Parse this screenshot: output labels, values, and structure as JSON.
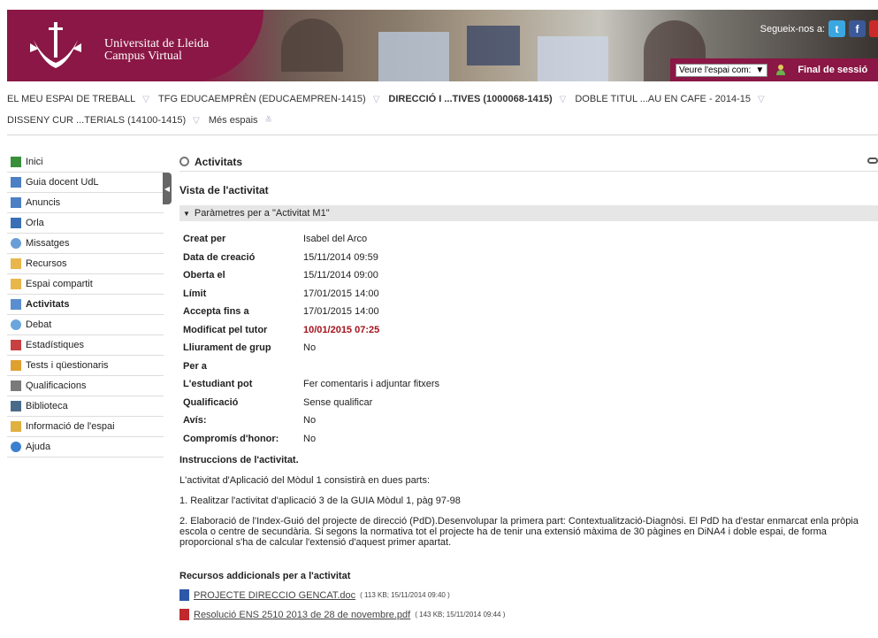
{
  "banner": {
    "uni_line1": "Universitat de Lleida",
    "uni_line2": "Campus Virtual",
    "follow_label": "Segueix-nos a:",
    "espai_select": "Veure l'espai com:",
    "logout": "Final de sessió"
  },
  "topnav": {
    "row1": [
      "EL MEU ESPAI DE TREBALL",
      "TFG EDUCAEMPRÈN (EDUCAEMPREN-1415)",
      "DIRECCIÓ I ...TIVES (1000068-1415)",
      "DOBLE TITUL ...AU EN CAFE - 2014-15"
    ],
    "row2": [
      "DISSENY CUR ...TERIALS (14100-1415)",
      "Més espais"
    ]
  },
  "sidebar": {
    "items": [
      {
        "label": "Inici",
        "icon": "home-icon"
      },
      {
        "label": "Guia docent UdL",
        "icon": "guide-icon"
      },
      {
        "label": "Anuncis",
        "icon": "megaphone-icon"
      },
      {
        "label": "Orla",
        "icon": "orla-icon"
      },
      {
        "label": "Missatges",
        "icon": "message-icon"
      },
      {
        "label": "Recursos",
        "icon": "folder-icon"
      },
      {
        "label": "Espai compartit",
        "icon": "shared-folder-icon"
      },
      {
        "label": "Activitats",
        "icon": "activity-icon"
      },
      {
        "label": "Debat",
        "icon": "debate-icon"
      },
      {
        "label": "Estadístiques",
        "icon": "stats-icon"
      },
      {
        "label": "Tests i qüestionaris",
        "icon": "pencil-icon"
      },
      {
        "label": "Qualificacions",
        "icon": "grades-icon"
      },
      {
        "label": "Biblioteca",
        "icon": "library-icon"
      },
      {
        "label": "Informació de l'espai",
        "icon": "info-icon"
      },
      {
        "label": "Ajuda",
        "icon": "help-icon"
      }
    ],
    "active": "Activitats"
  },
  "main": {
    "section_title": "Activitats",
    "view_title": "Vista de l'activitat",
    "params_bar": "Paràmetres per a \"Activitat M1\"",
    "params": [
      {
        "label": "Creat per",
        "value": "Isabel del Arco"
      },
      {
        "label": "Data de creació",
        "value": "15/11/2014 09:59"
      },
      {
        "label": "Oberta el",
        "value": "15/11/2014 09:00"
      },
      {
        "label": "Límit",
        "value": "17/01/2015 14:00"
      },
      {
        "label": "Accepta fins a",
        "value": "17/01/2015 14:00"
      },
      {
        "label": "Modificat pel tutor",
        "value": "10/01/2015 07:25",
        "highlight": true
      },
      {
        "label": "Lliurament de grup",
        "value": "No"
      },
      {
        "label": "Per a",
        "value": ""
      },
      {
        "label": "L'estudiant pot",
        "value": "Fer comentaris i adjuntar fitxers"
      },
      {
        "label": "Qualificació",
        "value": "Sense qualificar"
      },
      {
        "label": "Avís:",
        "value": "No"
      },
      {
        "label": "Compromís d'honor:",
        "value": "No"
      }
    ],
    "instructions_title": "Instruccions de l'activitat.",
    "paragraphs": [
      "L'activitat d'Aplicació  del Mòdul 1 consistirà en dues parts:",
      "1. Realitzar l'activitat d'aplicació 3 de la GUIA Mòdul 1, pàg 97-98",
      "2. Elaboració de l'Index-Guió del projecte de direcció (PdD).Desenvolupar la primera part: Contextualització-Diagnòsi. El PdD ha d'estar enmarcat enla pròpia escola o centre de secundària. Si segons la normativa tot el projecte ha de tenir una extensió màxima de 30 pàgines en DiNA4 i doble espai, de forma proporcional s'ha de calcular l'extensió d'aquest primer apartat."
    ],
    "resources_title": "Recursos addicionals per a l'activitat",
    "files": [
      {
        "name": "PROJECTE DIRECCIO GENCAT.doc",
        "meta": "( 113 KB; 15/11/2014 09:40 )",
        "type": "doc"
      },
      {
        "name": "Resolució ENS 2510 2013 de 28 de novembre.pdf",
        "meta": "( 143 KB; 15/11/2014 09:44 )",
        "type": "pdf"
      }
    ]
  }
}
